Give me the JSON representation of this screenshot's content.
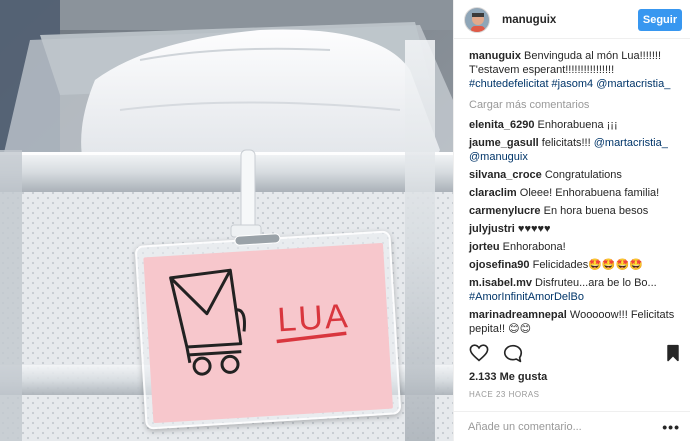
{
  "header": {
    "username": "manuguix",
    "follow_label": "Seguir"
  },
  "photo": {
    "tag_text": "LUA"
  },
  "caption": {
    "username": "manuguix",
    "text": "Benvinguda al món Lua!!!!!!! T'estavem esperant!!!!!!!!!!!!!!!!",
    "hashtags": "#chutedefelicitat #jasom4 @martacristia_"
  },
  "load_more_label": "Cargar más comentarios",
  "comments": [
    {
      "username": "elenita_6290",
      "text": "Enhorabuena ¡¡¡"
    },
    {
      "username": "jaume_gasull",
      "text": "felicitats!!! ",
      "link": "@martacristia_ @manuguix"
    },
    {
      "username": "silvana_croce",
      "text": "Congratulations"
    },
    {
      "username": "claraclim",
      "text": "Oleee! Enhorabuena familia!"
    },
    {
      "username": "carmenylucre",
      "text": "En hora buena besos"
    },
    {
      "username": "julyjustri",
      "text": "♥♥♥♥♥"
    },
    {
      "username": "jorteu",
      "text": "Enhorabona!"
    },
    {
      "username": "ojosefina90",
      "text": "Felicidades🤩🤩🤩🤩"
    },
    {
      "username": "m.isabel.mv",
      "text": "Disfruteu...ara be lo Bo...",
      "link": "#AmorInfinitAmorDelBo"
    },
    {
      "username": "marinadreamnepal",
      "text": "Wooooow!!! Felicitats pepita!! 😊😊"
    }
  ],
  "likes_label": "2.133 Me gusta",
  "time_ago": "HACE 23 HORAS",
  "add_comment": {
    "placeholder": "Añade un comentario...",
    "more_label": "•••"
  },
  "icons": {
    "like": "heart-icon",
    "comment": "comment-bubble-icon",
    "save": "bookmark-icon",
    "more": "more-dots-icon"
  },
  "colors": {
    "accent": "#3897f0",
    "link": "#003569",
    "muted": "#999999",
    "tag_card": "#f7c7cc",
    "tag_ink_red": "#d9363e"
  }
}
